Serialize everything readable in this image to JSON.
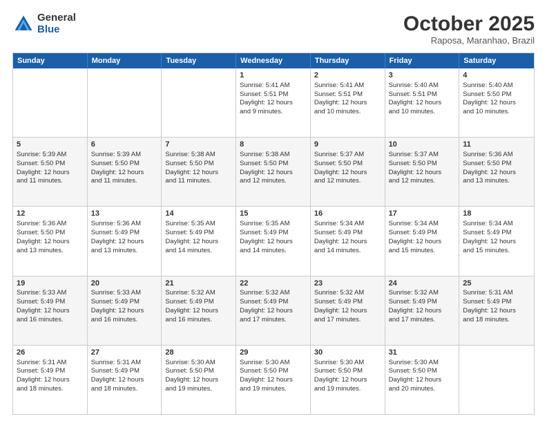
{
  "header": {
    "logo_general": "General",
    "logo_blue": "Blue",
    "month_title": "October 2025",
    "subtitle": "Raposa, Maranhao, Brazil"
  },
  "weekdays": [
    "Sunday",
    "Monday",
    "Tuesday",
    "Wednesday",
    "Thursday",
    "Friday",
    "Saturday"
  ],
  "rows": [
    [
      {
        "day": "",
        "lines": []
      },
      {
        "day": "",
        "lines": []
      },
      {
        "day": "",
        "lines": []
      },
      {
        "day": "1",
        "lines": [
          "Sunrise: 5:41 AM",
          "Sunset: 5:51 PM",
          "Daylight: 12 hours",
          "and 9 minutes."
        ]
      },
      {
        "day": "2",
        "lines": [
          "Sunrise: 5:41 AM",
          "Sunset: 5:51 PM",
          "Daylight: 12 hours",
          "and 10 minutes."
        ]
      },
      {
        "day": "3",
        "lines": [
          "Sunrise: 5:40 AM",
          "Sunset: 5:51 PM",
          "Daylight: 12 hours",
          "and 10 minutes."
        ]
      },
      {
        "day": "4",
        "lines": [
          "Sunrise: 5:40 AM",
          "Sunset: 5:50 PM",
          "Daylight: 12 hours",
          "and 10 minutes."
        ]
      }
    ],
    [
      {
        "day": "5",
        "lines": [
          "Sunrise: 5:39 AM",
          "Sunset: 5:50 PM",
          "Daylight: 12 hours",
          "and 11 minutes."
        ]
      },
      {
        "day": "6",
        "lines": [
          "Sunrise: 5:39 AM",
          "Sunset: 5:50 PM",
          "Daylight: 12 hours",
          "and 11 minutes."
        ]
      },
      {
        "day": "7",
        "lines": [
          "Sunrise: 5:38 AM",
          "Sunset: 5:50 PM",
          "Daylight: 12 hours",
          "and 11 minutes."
        ]
      },
      {
        "day": "8",
        "lines": [
          "Sunrise: 5:38 AM",
          "Sunset: 5:50 PM",
          "Daylight: 12 hours",
          "and 12 minutes."
        ]
      },
      {
        "day": "9",
        "lines": [
          "Sunrise: 5:37 AM",
          "Sunset: 5:50 PM",
          "Daylight: 12 hours",
          "and 12 minutes."
        ]
      },
      {
        "day": "10",
        "lines": [
          "Sunrise: 5:37 AM",
          "Sunset: 5:50 PM",
          "Daylight: 12 hours",
          "and 12 minutes."
        ]
      },
      {
        "day": "11",
        "lines": [
          "Sunrise: 5:36 AM",
          "Sunset: 5:50 PM",
          "Daylight: 12 hours",
          "and 13 minutes."
        ]
      }
    ],
    [
      {
        "day": "12",
        "lines": [
          "Sunrise: 5:36 AM",
          "Sunset: 5:50 PM",
          "Daylight: 12 hours",
          "and 13 minutes."
        ]
      },
      {
        "day": "13",
        "lines": [
          "Sunrise: 5:36 AM",
          "Sunset: 5:49 PM",
          "Daylight: 12 hours",
          "and 13 minutes."
        ]
      },
      {
        "day": "14",
        "lines": [
          "Sunrise: 5:35 AM",
          "Sunset: 5:49 PM",
          "Daylight: 12 hours",
          "and 14 minutes."
        ]
      },
      {
        "day": "15",
        "lines": [
          "Sunrise: 5:35 AM",
          "Sunset: 5:49 PM",
          "Daylight: 12 hours",
          "and 14 minutes."
        ]
      },
      {
        "day": "16",
        "lines": [
          "Sunrise: 5:34 AM",
          "Sunset: 5:49 PM",
          "Daylight: 12 hours",
          "and 14 minutes."
        ]
      },
      {
        "day": "17",
        "lines": [
          "Sunrise: 5:34 AM",
          "Sunset: 5:49 PM",
          "Daylight: 12 hours",
          "and 15 minutes."
        ]
      },
      {
        "day": "18",
        "lines": [
          "Sunrise: 5:34 AM",
          "Sunset: 5:49 PM",
          "Daylight: 12 hours",
          "and 15 minutes."
        ]
      }
    ],
    [
      {
        "day": "19",
        "lines": [
          "Sunrise: 5:33 AM",
          "Sunset: 5:49 PM",
          "Daylight: 12 hours",
          "and 16 minutes."
        ]
      },
      {
        "day": "20",
        "lines": [
          "Sunrise: 5:33 AM",
          "Sunset: 5:49 PM",
          "Daylight: 12 hours",
          "and 16 minutes."
        ]
      },
      {
        "day": "21",
        "lines": [
          "Sunrise: 5:32 AM",
          "Sunset: 5:49 PM",
          "Daylight: 12 hours",
          "and 16 minutes."
        ]
      },
      {
        "day": "22",
        "lines": [
          "Sunrise: 5:32 AM",
          "Sunset: 5:49 PM",
          "Daylight: 12 hours",
          "and 17 minutes."
        ]
      },
      {
        "day": "23",
        "lines": [
          "Sunrise: 5:32 AM",
          "Sunset: 5:49 PM",
          "Daylight: 12 hours",
          "and 17 minutes."
        ]
      },
      {
        "day": "24",
        "lines": [
          "Sunrise: 5:32 AM",
          "Sunset: 5:49 PM",
          "Daylight: 12 hours",
          "and 17 minutes."
        ]
      },
      {
        "day": "25",
        "lines": [
          "Sunrise: 5:31 AM",
          "Sunset: 5:49 PM",
          "Daylight: 12 hours",
          "and 18 minutes."
        ]
      }
    ],
    [
      {
        "day": "26",
        "lines": [
          "Sunrise: 5:31 AM",
          "Sunset: 5:49 PM",
          "Daylight: 12 hours",
          "and 18 minutes."
        ]
      },
      {
        "day": "27",
        "lines": [
          "Sunrise: 5:31 AM",
          "Sunset: 5:49 PM",
          "Daylight: 12 hours",
          "and 18 minutes."
        ]
      },
      {
        "day": "28",
        "lines": [
          "Sunrise: 5:30 AM",
          "Sunset: 5:50 PM",
          "Daylight: 12 hours",
          "and 19 minutes."
        ]
      },
      {
        "day": "29",
        "lines": [
          "Sunrise: 5:30 AM",
          "Sunset: 5:50 PM",
          "Daylight: 12 hours",
          "and 19 minutes."
        ]
      },
      {
        "day": "30",
        "lines": [
          "Sunrise: 5:30 AM",
          "Sunset: 5:50 PM",
          "Daylight: 12 hours",
          "and 19 minutes."
        ]
      },
      {
        "day": "31",
        "lines": [
          "Sunrise: 5:30 AM",
          "Sunset: 5:50 PM",
          "Daylight: 12 hours",
          "and 20 minutes."
        ]
      },
      {
        "day": "",
        "lines": []
      }
    ]
  ]
}
